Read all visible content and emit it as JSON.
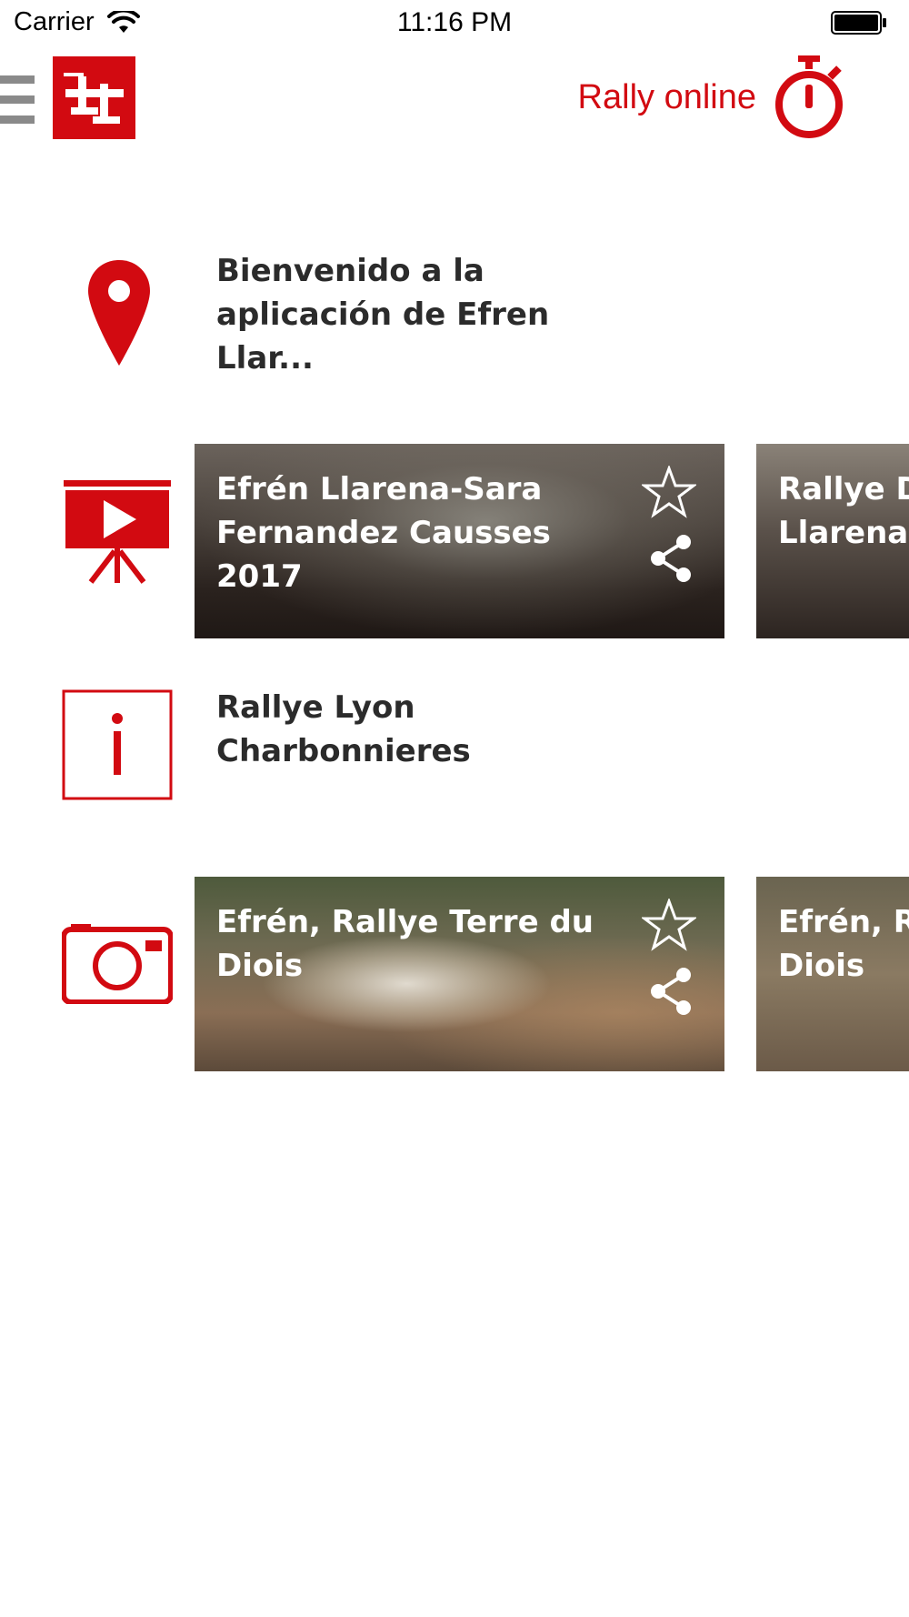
{
  "status_bar": {
    "carrier": "Carrier",
    "time": "11:16 PM",
    "icons": [
      "wifi-icon",
      "battery-icon"
    ]
  },
  "header": {
    "menu_icon": "hamburger-icon",
    "logo": "efren-llarena-logo",
    "rally_online_label": "Rally online",
    "rally_online_icon": "stopwatch-icon"
  },
  "feed": [
    {
      "type": "news",
      "icon": "location-pin-icon",
      "title": "Bienvenido a la aplicación de Efren Llar..."
    },
    {
      "type": "videos",
      "icon": "video-presentation-icon",
      "cards": [
        {
          "title": "Efrén Llarena-Sara Fernandez Causses 2017"
        },
        {
          "title": "Rallye D\nLlarena"
        }
      ]
    },
    {
      "type": "info",
      "icon": "info-icon",
      "title": "Rallye Lyon Charbonnieres"
    },
    {
      "type": "photos",
      "icon": "camera-icon",
      "cards": [
        {
          "title": "Efrén, Rallye Terre du Diois"
        },
        {
          "title": "Efrén, R\nDiois"
        }
      ]
    }
  ],
  "colors": {
    "accent": "#d20a11",
    "text": "#2b2b2b"
  }
}
